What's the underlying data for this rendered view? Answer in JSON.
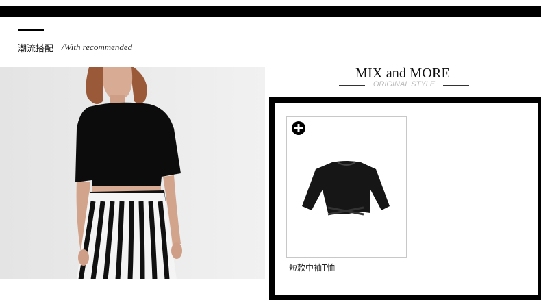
{
  "section": {
    "title": "潮流搭配",
    "subtitle": "/With recommended"
  },
  "mix": {
    "title": "MIX and MORE",
    "subtitle": "ORIGINAL STYLE"
  },
  "product": {
    "name": "短款中袖T恤",
    "add_icon": "plus-circle-icon"
  },
  "colors": {
    "frame": "#000000",
    "top_bar": "#000000",
    "subtitle_gray": "#bbbbbb"
  }
}
